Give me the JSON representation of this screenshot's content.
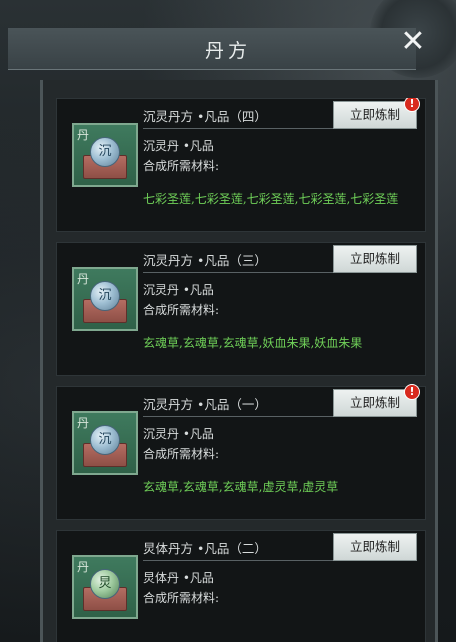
{
  "header": {
    "title": "丹方",
    "close_label": "✕"
  },
  "cards": [
    {
      "title": "沉灵丹方 •凡品（四）",
      "button_label": "立即炼制",
      "alert": "!",
      "pill": "沉灵丹 •凡品",
      "materials_label": "合成所需材料:",
      "materials": "七彩圣莲,七彩圣莲,七彩圣莲,七彩圣莲,七彩圣莲",
      "icon_char": "丹",
      "orb_char": "沉"
    },
    {
      "title": "沉灵丹方 •凡品（三）",
      "button_label": "立即炼制",
      "pill": "沉灵丹 •凡品",
      "materials_label": "合成所需材料:",
      "materials": "玄魂草,玄魂草,玄魂草,妖血朱果,妖血朱果",
      "icon_char": "丹",
      "orb_char": "沉"
    },
    {
      "title": "沉灵丹方 •凡品（一）",
      "button_label": "立即炼制",
      "alert": "!",
      "pill": "沉灵丹 •凡品",
      "materials_label": "合成所需材料:",
      "materials": "玄魂草,玄魂草,玄魂草,虚灵草,虚灵草",
      "icon_char": "丹",
      "orb_char": "沉"
    },
    {
      "title": "炅体丹方 •凡品（二）",
      "button_label": "立即炼制",
      "pill": "炅体丹 •凡品",
      "materials_label": "合成所需材料:",
      "icon_char": "丹",
      "orb_char": "炅"
    }
  ]
}
